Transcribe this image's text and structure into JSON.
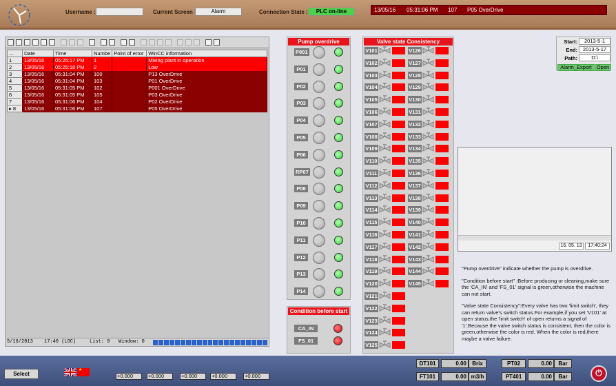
{
  "header": {
    "username_label": "Username :",
    "username_value": "",
    "screen_label": "Current Screen :",
    "screen_value": "Alarm",
    "conn_label": "Connection State :",
    "conn_value": "PLC on-line",
    "alarmline": {
      "date": "13/05/16",
      "time": "05:31:06 PM",
      "num": "107",
      "text": "P05 OverDrive"
    }
  },
  "alarm_table": {
    "headers": [
      "...",
      "Date",
      "Time",
      "Numbe",
      "Point of error",
      "WinCC information"
    ],
    "rows": [
      {
        "idx": "1",
        "date": "13/05/16",
        "time": "05:25:17 PM",
        "num": "1",
        "point": "",
        "info": "Mixing plant in operation",
        "style": "red"
      },
      {
        "idx": "2",
        "date": "13/05/16",
        "time": "05:25:18 PM",
        "num": "2",
        "point": "",
        "info": "Low",
        "style": "red"
      },
      {
        "idx": "3",
        "date": "13/05/16",
        "time": "05:31:04 PM",
        "num": "100",
        "point": "",
        "info": "P13 OverDrive",
        "style": "dark"
      },
      {
        "idx": "4",
        "date": "13/05/16",
        "time": "05:31:04 PM",
        "num": "103",
        "point": "",
        "info": "P01 OverDrive",
        "style": "dark"
      },
      {
        "idx": "5",
        "date": "13/05/16",
        "time": "05:31:05 PM",
        "num": "102",
        "point": "",
        "info": "P001 OverDrive",
        "style": "dark"
      },
      {
        "idx": "6",
        "date": "13/05/16",
        "time": "05:31:05 PM",
        "num": "105",
        "point": "",
        "info": "P03 OverDrive",
        "style": "dark"
      },
      {
        "idx": "7",
        "date": "13/05/16",
        "time": "05:31:06 PM",
        "num": "104",
        "point": "",
        "info": "P02 OverDrive",
        "style": "dark"
      },
      {
        "idx": "▸ 8",
        "date": "13/05/16",
        "time": "05:31:06 PM",
        "num": "107",
        "point": "",
        "info": "P05 OverDrive",
        "style": "dark"
      }
    ],
    "status": {
      "date": "5/16/2013",
      "time": "17:40 (LOC)",
      "list": "List: 0",
      "window": "Window: 0"
    }
  },
  "pump_panel": {
    "title": "Pump overdrive",
    "pumps": [
      "P001",
      "P01",
      "P02",
      "P03",
      "P04",
      "P05",
      "P06",
      "RP07",
      "P08",
      "P09",
      "P10",
      "P11",
      "P12",
      "P13",
      "P14"
    ]
  },
  "condition_panel": {
    "title": "Condition before start",
    "items": [
      "CA_IN",
      "FS_01"
    ]
  },
  "valve_panel": {
    "title": "Valve state Consistency",
    "col1": [
      "V101",
      "V102",
      "V103",
      "V104",
      "V105",
      "V106",
      "V107",
      "V108",
      "V109",
      "V110",
      "V111",
      "V112",
      "V113",
      "V114",
      "V115",
      "V116",
      "V117",
      "V118",
      "V119",
      "V120",
      "V121",
      "V122",
      "V123",
      "V124",
      "V125"
    ],
    "col2": [
      "V126",
      "V127",
      "V128",
      "V129",
      "V130",
      "V131",
      "V132",
      "V133",
      "V134",
      "V135",
      "V136",
      "V137",
      "V138",
      "V139",
      "V140",
      "V141",
      "V142",
      "V143",
      "V144",
      "V145"
    ]
  },
  "export": {
    "start_label": "Start:",
    "start_value": "2013-5-1",
    "end_label": "End:",
    "end_value": "2013-5-17",
    "path_label": "Path:",
    "path_value": "D:\\",
    "export_btn": "Alarm_Export",
    "open_btn": "Open"
  },
  "preview": {
    "date": "16. 05. 13",
    "time": "17:40:24"
  },
  "notes": [
    "\"Pump overdrive\" indicate whether the pump is overdrive.",
    "\"Condition before start\" :Before producing or cleaning,make sure the 'CA_IN' and 'FS_01' signal is green,otherwise the machine can not start.",
    "\"Valve state Consistency\":Every valve has two 'limit switch', they can return  valve's switch status.For example,if you set 'V101' at open status,the 'limit switch' of open returns a signal of '1'.Because the valve switch status is consistent, then the color  is green,otherwise the color is red. When the color is red,there maybe a valve failure."
  ],
  "footer": {
    "select_label": "Select",
    "values": [
      "+0.000",
      "+0.000",
      "+0.000",
      "+0.000",
      "+0.000"
    ],
    "measurements": [
      {
        "tag": "DT101",
        "value": "0.00",
        "unit": "Brix"
      },
      {
        "tag": "FT101",
        "value": "0.00",
        "unit": "m3/h"
      },
      {
        "tag": "PT02",
        "value": "0.00",
        "unit": "Bar"
      },
      {
        "tag": "PT401",
        "value": "0.00",
        "unit": "Bar"
      }
    ]
  }
}
